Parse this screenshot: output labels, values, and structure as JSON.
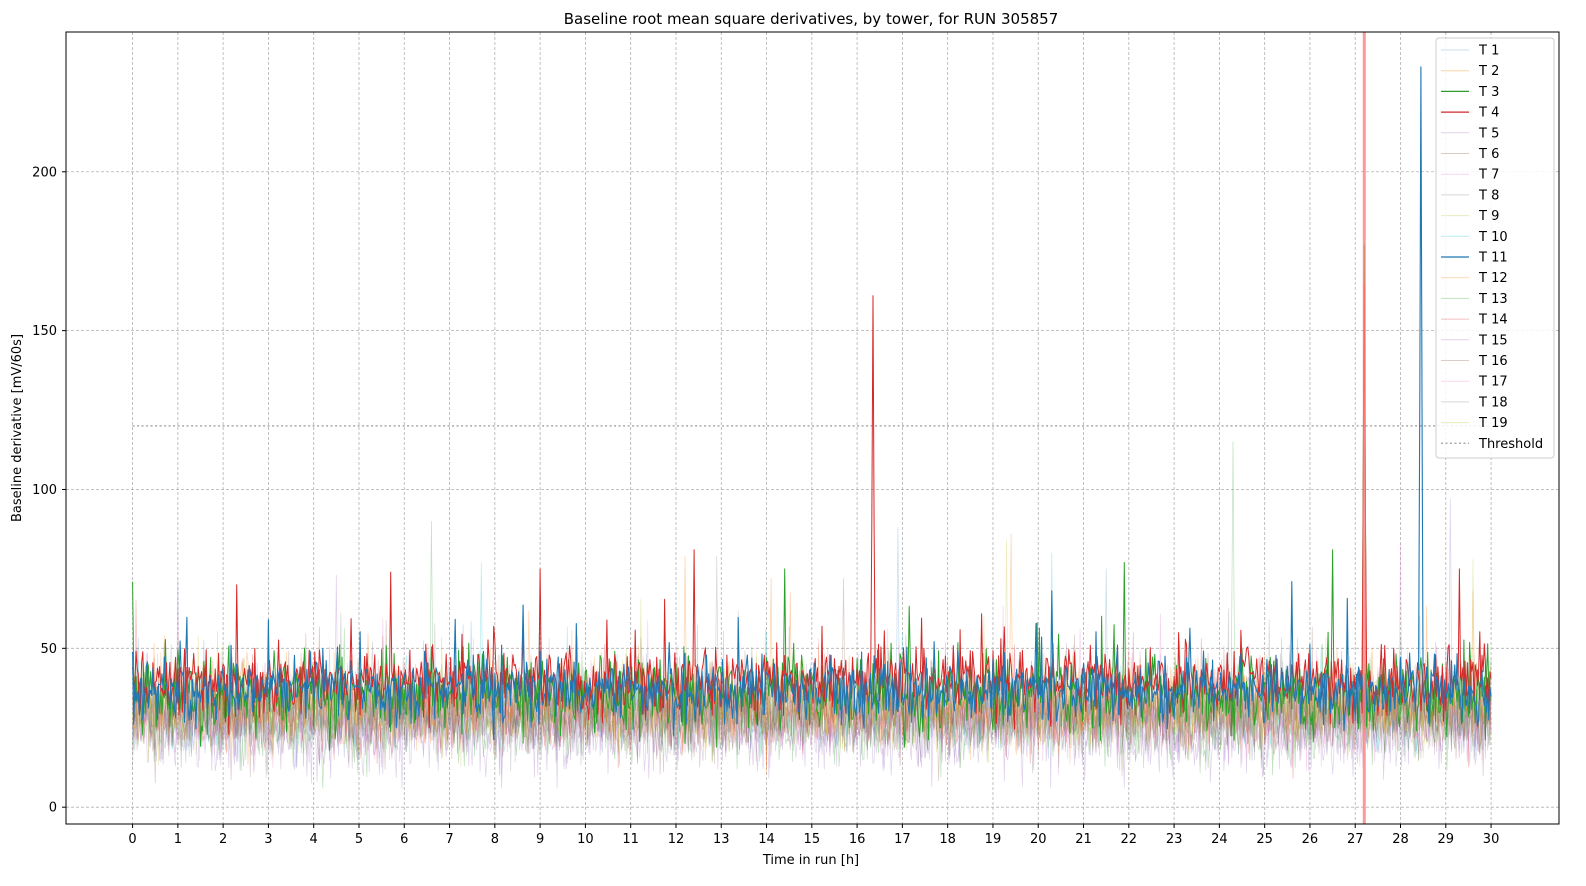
{
  "chart_data": {
    "type": "line",
    "title": "Baseline root mean square derivatives, by tower, for RUN 305857",
    "xlabel": "Time in run [h]",
    "ylabel": "Baseline derivative [mV/60s]",
    "xlim": [
      -1.47,
      31.5
    ],
    "ylim": [
      -5.3,
      244
    ],
    "xticks": [
      0,
      1,
      2,
      3,
      4,
      5,
      6,
      7,
      8,
      9,
      10,
      11,
      12,
      13,
      14,
      15,
      16,
      17,
      18,
      19,
      20,
      21,
      22,
      23,
      24,
      25,
      26,
      27,
      28,
      29,
      30
    ],
    "xtick_labels": [
      "0",
      "1",
      "2",
      "3",
      "4",
      "5",
      "6",
      "7",
      "8",
      "9",
      "10",
      "11",
      "12",
      "13",
      "14",
      "15",
      "16",
      "17",
      "18",
      "19",
      "20",
      "21",
      "22",
      "23",
      "24",
      "25",
      "26",
      "27",
      "28",
      "29",
      "30"
    ],
    "yticks": [
      0,
      50,
      100,
      150,
      200
    ],
    "ytick_labels": [
      "0",
      "50",
      "100",
      "150",
      "200"
    ],
    "grid": true,
    "legend_position": "top-right",
    "threshold": {
      "name": "Threshold",
      "value": 120,
      "x_range": [
        0,
        30
      ],
      "color": "#aaaaaa",
      "style": "dotted"
    },
    "marker_vline": {
      "x": 27.2,
      "color": "#ff7f7f"
    },
    "x_resolution_h": 0.025,
    "series": [
      {
        "name": "T 1",
        "color": "#1f77b4",
        "alpha": 0.25,
        "width": 0.7,
        "mean": 32,
        "sd": 6,
        "spikes": [
          [
            16.9,
            88
          ],
          [
            21.5,
            75
          ]
        ]
      },
      {
        "name": "T 2",
        "color": "#ff7f0e",
        "alpha": 0.35,
        "width": 0.7,
        "mean": 34,
        "sd": 6,
        "spikes": [
          [
            12.2,
            79
          ],
          [
            14.1,
            72
          ],
          [
            19.4,
            86
          ]
        ]
      },
      {
        "name": "T 3",
        "color": "#2ca02c",
        "alpha": 1.0,
        "width": 1.0,
        "mean": 36,
        "sd": 6,
        "spikes": [
          [
            0.0,
            71
          ],
          [
            14.4,
            75
          ],
          [
            21.9,
            77
          ],
          [
            26.5,
            81
          ],
          [
            27.2,
            177
          ]
        ]
      },
      {
        "name": "T 4",
        "color": "#d62728",
        "alpha": 1.0,
        "width": 1.0,
        "mean": 40,
        "sd": 5,
        "spikes": [
          [
            2.3,
            70
          ],
          [
            5.7,
            74
          ],
          [
            9.0,
            75
          ],
          [
            12.4,
            81
          ],
          [
            16.35,
            161
          ],
          [
            27.2,
            165
          ],
          [
            29.3,
            75
          ]
        ]
      },
      {
        "name": "T 5",
        "color": "#9467bd",
        "alpha": 0.3,
        "width": 0.7,
        "mean": 24,
        "sd": 6,
        "spikes": [
          [
            4.5,
            73
          ],
          [
            29.1,
            97
          ]
        ]
      },
      {
        "name": "T 6",
        "color": "#8c564b",
        "alpha": 0.3,
        "width": 0.7,
        "mean": 30,
        "sd": 6,
        "spikes": [
          [
            15.7,
            72
          ]
        ]
      },
      {
        "name": "T 7",
        "color": "#e377c2",
        "alpha": 0.3,
        "width": 0.7,
        "mean": 31,
        "sd": 6,
        "spikes": [
          [
            28.0,
            83
          ]
        ]
      },
      {
        "name": "T 8",
        "color": "#7f7f7f",
        "alpha": 0.3,
        "width": 0.7,
        "mean": 30,
        "sd": 6,
        "spikes": [
          [
            12.9,
            79
          ]
        ]
      },
      {
        "name": "T 9",
        "color": "#bcbd22",
        "alpha": 0.3,
        "width": 0.7,
        "mean": 31,
        "sd": 6,
        "spikes": [
          [
            19.3,
            84
          ]
        ]
      },
      {
        "name": "T 10",
        "color": "#17becf",
        "alpha": 0.3,
        "width": 0.7,
        "mean": 32,
        "sd": 6,
        "spikes": [
          [
            7.7,
            77
          ],
          [
            20.3,
            80
          ]
        ]
      },
      {
        "name": "T 11",
        "color": "#1f77b4",
        "alpha": 1.0,
        "width": 1.1,
        "mean": 37,
        "sd": 5,
        "spikes": [
          [
            3.0,
            59
          ],
          [
            25.6,
            71
          ],
          [
            28.45,
            233
          ]
        ]
      },
      {
        "name": "T 12",
        "color": "#ff7f0e",
        "alpha": 0.3,
        "width": 0.7,
        "mean": 32,
        "sd": 6,
        "spikes": [
          [
            29.6,
            68
          ]
        ]
      },
      {
        "name": "T 13",
        "color": "#2ca02c",
        "alpha": 0.3,
        "width": 0.7,
        "mean": 26,
        "sd": 6,
        "spikes": [
          [
            6.6,
            90
          ],
          [
            24.3,
            115
          ]
        ]
      },
      {
        "name": "T 14",
        "color": "#d62728",
        "alpha": 0.3,
        "width": 0.7,
        "mean": 30,
        "sd": 6,
        "spikes": []
      },
      {
        "name": "T 15",
        "color": "#9467bd",
        "alpha": 0.3,
        "width": 0.7,
        "mean": 24,
        "sd": 6,
        "spikes": [
          [
            1.0,
            72
          ]
        ]
      },
      {
        "name": "T 16",
        "color": "#8c564b",
        "alpha": 0.3,
        "width": 0.7,
        "mean": 30,
        "sd": 6,
        "spikes": []
      },
      {
        "name": "T 17",
        "color": "#e377c2",
        "alpha": 0.3,
        "width": 0.7,
        "mean": 31,
        "sd": 6,
        "spikes": []
      },
      {
        "name": "T 18",
        "color": "#7f7f7f",
        "alpha": 0.3,
        "width": 0.7,
        "mean": 30,
        "sd": 6,
        "spikes": []
      },
      {
        "name": "T 19",
        "color": "#bcbd22",
        "alpha": 0.3,
        "width": 0.7,
        "mean": 31,
        "sd": 6,
        "spikes": [
          [
            29.6,
            78
          ]
        ]
      }
    ]
  }
}
